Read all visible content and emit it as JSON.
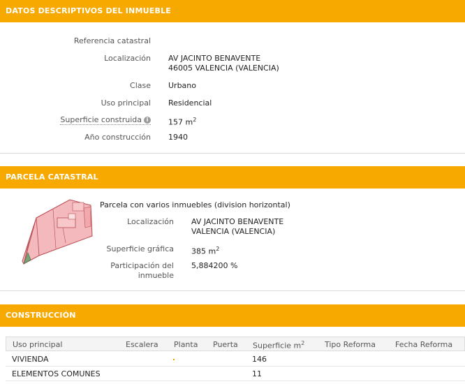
{
  "section1": {
    "title": "DATOS DESCRIPTIVOS DEL INMUEBLE",
    "fields": {
      "ref_label": "Referencia catastral",
      "loc_label": "Localización",
      "loc_line1": "AV JACINTO BENAVENTE",
      "loc_line2": "46005 VALENCIA (VALENCIA)",
      "clase_label": "Clase",
      "clase_value": "Urbano",
      "uso_label": "Uso principal",
      "uso_value": "Residencial",
      "sup_label": "Superficie construida",
      "sup_value": "157 m",
      "sup_unit_sup": "2",
      "anio_label": "Año construcción",
      "anio_value": "1940"
    }
  },
  "section2": {
    "title": "PARCELA CATASTRAL",
    "caption": "Parcela con varios inmuebles (division horizontal)",
    "loc_label": "Localización",
    "loc_line1": "AV JACINTO BENAVENTE",
    "loc_line2": "VALENCIA (VALENCIA)",
    "supg_label": "Superficie gráfica",
    "supg_value": "385 m",
    "supg_unit_sup": "2",
    "part_label_1": "Participación del",
    "part_label_2": "inmueble",
    "part_value": "5,884200 %"
  },
  "section3": {
    "title": "CONSTRUCCIÓN",
    "headers": {
      "uso": "Uso principal",
      "escalera": "Escalera",
      "planta": "Planta",
      "puerta": "Puerta",
      "superficie": "Superficie m",
      "superficie_sup": "2",
      "tipo": "Tipo Reforma",
      "fecha": "Fecha Reforma"
    },
    "rows": [
      {
        "uso": "VIVIENDA",
        "superficie": "146"
      },
      {
        "uso": "ELEMENTOS COMUNES",
        "superficie": "11"
      }
    ]
  },
  "colors": {
    "header_orange": "#f8a900",
    "parcel_fill": "#f4b9bc",
    "parcel_stroke": "#c0555c"
  },
  "icons": {
    "info": "info-icon"
  }
}
